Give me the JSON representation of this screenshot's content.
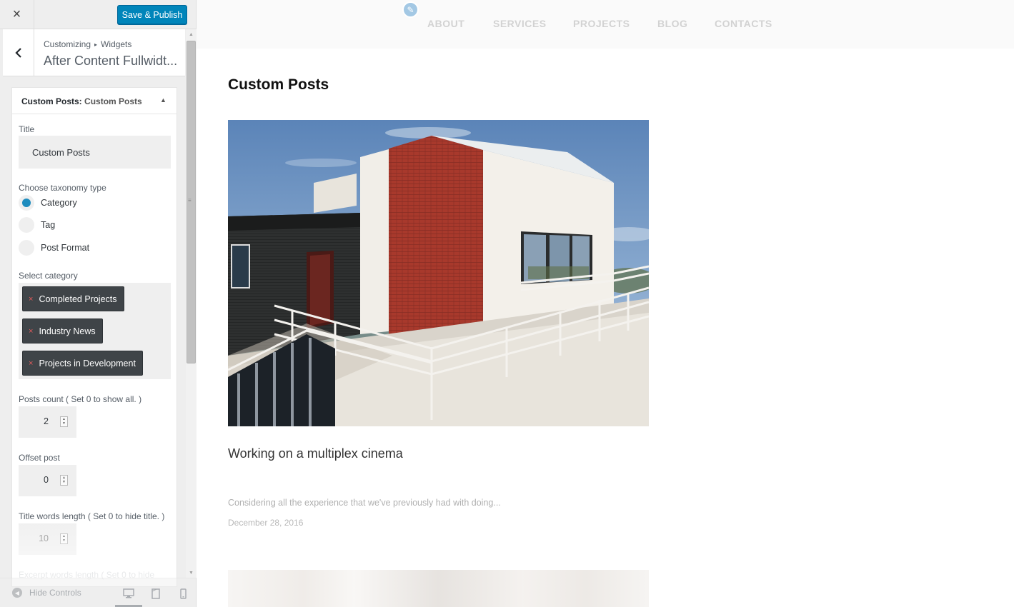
{
  "topbar": {
    "close_label": "×",
    "save_label": "Save & Publish"
  },
  "section": {
    "breadcrumb_root": "Customizing",
    "breadcrumb_sep": "▸",
    "breadcrumb_leaf": "Widgets",
    "title": "After Content Fullwidt...",
    "back_label": "‹"
  },
  "widget": {
    "name": "Custom Posts:",
    "instance": "Custom Posts",
    "toggle": "▲",
    "title_label": "Title",
    "title_value": "Custom Posts",
    "taxonomy_label": "Choose taxonomy type",
    "taxonomy_options": [
      {
        "label": "Category",
        "selected": true
      },
      {
        "label": "Tag",
        "selected": false
      },
      {
        "label": "Post Format",
        "selected": false
      }
    ],
    "category_label": "Select category",
    "categories": [
      "Completed Projects",
      "Industry News",
      "Projects in Development"
    ],
    "remove_glyph": "×",
    "posts_count_label": "Posts count ( Set 0 to show all. )",
    "posts_count": "2",
    "offset_label": "Offset post",
    "offset": "0",
    "title_words_label": "Title words length ( Set 0 to hide title. )",
    "title_words": "10",
    "excerpt_words_label": "Excerpt words length ( Set 0 to hide"
  },
  "footer": {
    "hide_controls": "Hide Controls",
    "devices": [
      "desktop-icon",
      "tablet-icon",
      "mobile-icon"
    ]
  },
  "preview": {
    "nav": [
      "ABOUT",
      "SERVICES",
      "PROJECTS",
      "BLOG",
      "CONTACTS"
    ],
    "heading": "Custom Posts",
    "post": {
      "title": "Working on a multiplex cinema",
      "excerpt": "Considering all the experience that we've previously had with doing...",
      "date": "December 28, 2016"
    }
  },
  "colors": {
    "accent": "#0085ba",
    "tag_bg": "#3f4448",
    "radio_on": "#1e8cbe",
    "remove": "#e35b5b"
  }
}
